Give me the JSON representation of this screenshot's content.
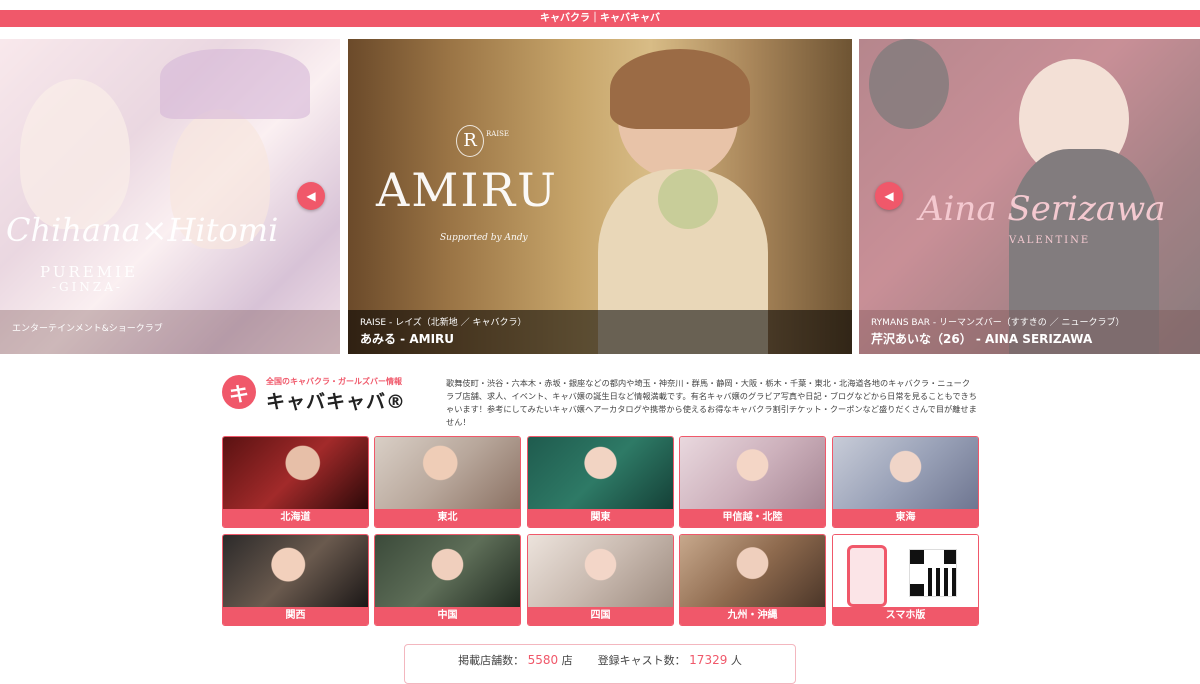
{
  "topbar": {
    "text": "キャバクラ｜キャバキャバ"
  },
  "carousel": {
    "prev_icon": "triangle-left-icon",
    "slides": [
      {
        "script": "Chihana×Hitomi",
        "brand": "PUREMIE",
        "brand_sub": "-GINZA-",
        "sub": "エンターテインメント&ショークラブ",
        "main": ""
      },
      {
        "script": "AMIRU",
        "brand": "RAISE",
        "brand_sub": "Supported by Andy",
        "sub": "RAISE - レイズ（北新地 ／ キャバクラ）",
        "main": "あみる - AMIRU"
      },
      {
        "script": "Aina Serizawa",
        "brand": "VALENTINE",
        "brand_sub": "",
        "sub": "RYMANS BAR - リーマンズバー（すすきの ／ ニュークラブ）",
        "main": "芹沢あいな（26） - AINA SERIZAWA"
      }
    ]
  },
  "logo": {
    "mark": "キ",
    "tagline": "全国のキャバクラ・ガールズバー情報",
    "name": "キャバキャバ®"
  },
  "description": "歌舞伎町・渋谷・六本木・赤坂・銀座などの都内や埼玉・神奈川・群馬・静岡・大阪・栃木・千葉・東北・北海道各地のキャバクラ・ニュークラブ店舗、求人、イベント、キャバ嬢の誕生日など情報満載です。有名キャバ嬢のグラビア写真や日記・ブログなどから日常を見ることもできちゃいます！参考にしてみたいキャバ嬢ヘアーカタログや携帯から使えるお得なキャバクラ割引チケット・クーポンなど盛りだくさんで目が離せません！",
  "regions": [
    {
      "label": "北海道"
    },
    {
      "label": "東北"
    },
    {
      "label": "関東"
    },
    {
      "label": "甲信越・北陸"
    },
    {
      "label": "東海"
    },
    {
      "label": "関西"
    },
    {
      "label": "中国"
    },
    {
      "label": "四国"
    },
    {
      "label": "九州・沖縄"
    },
    {
      "label": "スマホ版"
    }
  ],
  "stats": {
    "shops_label": "掲載店舗数：",
    "shops_value": "5580",
    "shops_unit": "店",
    "cast_label": "登録キャスト数：",
    "cast_value": "17329",
    "cast_unit": "人"
  },
  "colors": {
    "accent": "#f0586a"
  }
}
